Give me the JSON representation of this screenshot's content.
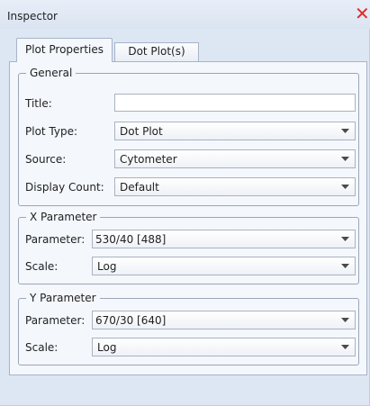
{
  "window": {
    "title": "Inspector",
    "close_icon": "close-icon",
    "close_glyph": "✕",
    "accent_close_color": "#e22b2b"
  },
  "tabs": [
    {
      "label": "Plot Properties",
      "active": true
    },
    {
      "label": "Dot Plot(s)",
      "active": false
    }
  ],
  "general": {
    "legend": "General",
    "title_label": "Title:",
    "title_value": "",
    "plot_type_label": "Plot Type:",
    "plot_type_value": "Dot Plot",
    "source_label": "Source:",
    "source_value": "Cytometer",
    "display_count_label": "Display Count:",
    "display_count_value": "Default"
  },
  "x_parameter": {
    "legend": "X Parameter",
    "parameter_label": "Parameter:",
    "parameter_value": "530/40 [488]",
    "scale_label": "Scale:",
    "scale_value": "Log"
  },
  "y_parameter": {
    "legend": "Y Parameter",
    "parameter_label": "Parameter:",
    "parameter_value": "670/30 [640]",
    "scale_label": "Scale:",
    "scale_value": "Log"
  }
}
